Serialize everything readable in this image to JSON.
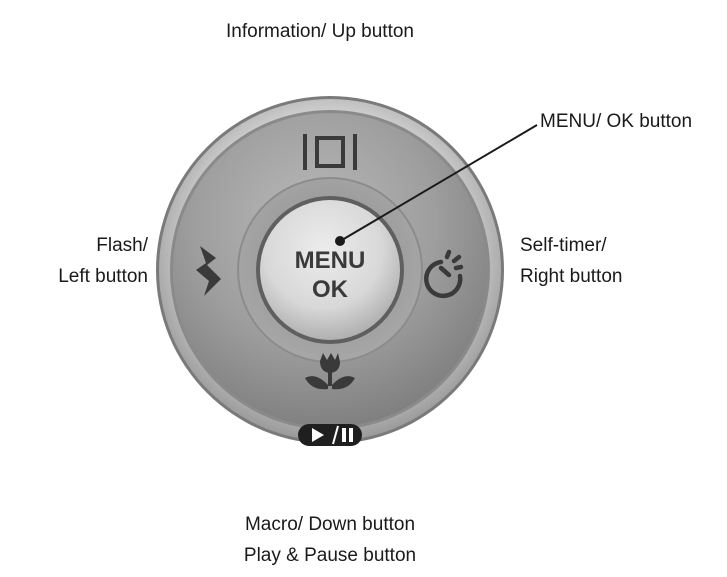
{
  "labels": {
    "up": "Information/ Up button",
    "menu_ok": "MENU/ OK button",
    "left": [
      "Flash/",
      "Left button"
    ],
    "right": [
      "Self-timer/",
      "Right button"
    ],
    "down": [
      "Macro/ Down button",
      "Play & Pause button"
    ]
  },
  "center_button": {
    "line1": "MENU",
    "line2": "OK"
  },
  "icons": {
    "up": "display-info-icon",
    "left": "flash-icon",
    "right": "self-timer-icon",
    "down": "macro-tulip-icon",
    "play_pause": "play-pause-icon"
  }
}
